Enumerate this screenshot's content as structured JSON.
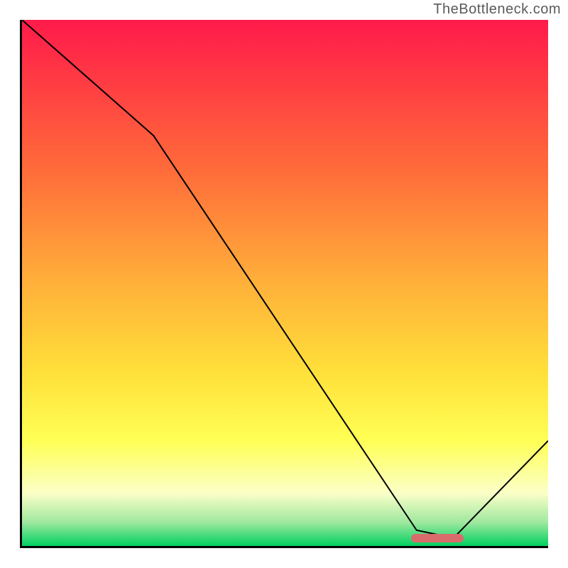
{
  "attribution": "TheBottleneck.com",
  "colors": {
    "top": "#ff1a4a",
    "mid1": "#ff6a3a",
    "mid2": "#ffb03a",
    "mid3": "#ffe03a",
    "yellow": "#ffff55",
    "pale": "#fbffc8",
    "green1": "#9fe89f",
    "green2": "#00d060",
    "curve": "#000000",
    "marker": "#da6b6d",
    "axis": "#000000"
  },
  "chart_data": {
    "type": "line",
    "title": "",
    "xlabel": "",
    "ylabel": "",
    "xlim": [
      0,
      100
    ],
    "ylim": [
      0,
      100
    ],
    "x": [
      0,
      25,
      75,
      82,
      100
    ],
    "y": [
      100,
      78,
      3,
      1.5,
      20
    ],
    "marker": {
      "x_start": 74,
      "x_end": 84,
      "y": 1.5
    },
    "gradient_stops": [
      {
        "pct": 0.0,
        "color_key": "top"
      },
      {
        "pct": 0.28,
        "color_key": "mid1"
      },
      {
        "pct": 0.5,
        "color_key": "mid2"
      },
      {
        "pct": 0.67,
        "color_key": "mid3"
      },
      {
        "pct": 0.8,
        "color_key": "yellow"
      },
      {
        "pct": 0.9,
        "color_key": "pale"
      },
      {
        "pct": 0.955,
        "color_key": "green1"
      },
      {
        "pct": 1.0,
        "color_key": "green2"
      }
    ]
  }
}
